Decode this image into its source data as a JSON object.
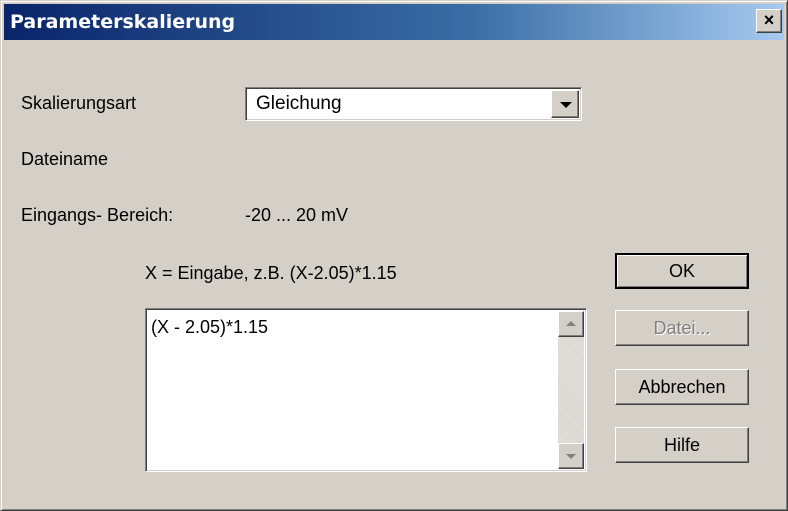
{
  "window": {
    "title": "Parameterskalierung",
    "close_label": "×"
  },
  "form": {
    "scaling_type_label": "Skalierungsart",
    "scaling_type_value": "Gleichung",
    "filename_label": "Dateiname",
    "input_range_label": "Eingangs- Bereich:",
    "input_range_value": "-20 ... 20 mV",
    "formula_hint": "X = Eingabe, z.B. (X-2.05)*1.15",
    "formula_value": "(X - 2.05)*1.15"
  },
  "buttons": {
    "ok": "OK",
    "file": "Datei...",
    "cancel": "Abbrechen",
    "help": "Hilfe"
  },
  "colors": {
    "titlebar_start": "#0a246a",
    "titlebar_end": "#a6caf0",
    "dialog_bg": "#d4d0c8"
  }
}
